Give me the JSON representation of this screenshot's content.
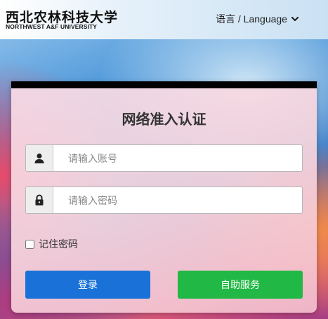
{
  "header": {
    "logo_cn": "西北农林科技大学",
    "logo_en": "NORTHWEST A&F UNIVERSITY",
    "language_label": "语言 / Language"
  },
  "card": {
    "title": "网络准入认证",
    "username_placeholder": "请输入账号",
    "password_placeholder": "请输入密码",
    "remember_label": "记住密码",
    "login_button": "登录",
    "self_service_button": "自助服务"
  },
  "icons": {
    "username": "user-icon",
    "password": "lock-icon",
    "language": "chevron-down-icon"
  },
  "colors": {
    "login_button": "#1a72d8",
    "self_service_button": "#22b845",
    "card_top_bar": "#000000"
  }
}
